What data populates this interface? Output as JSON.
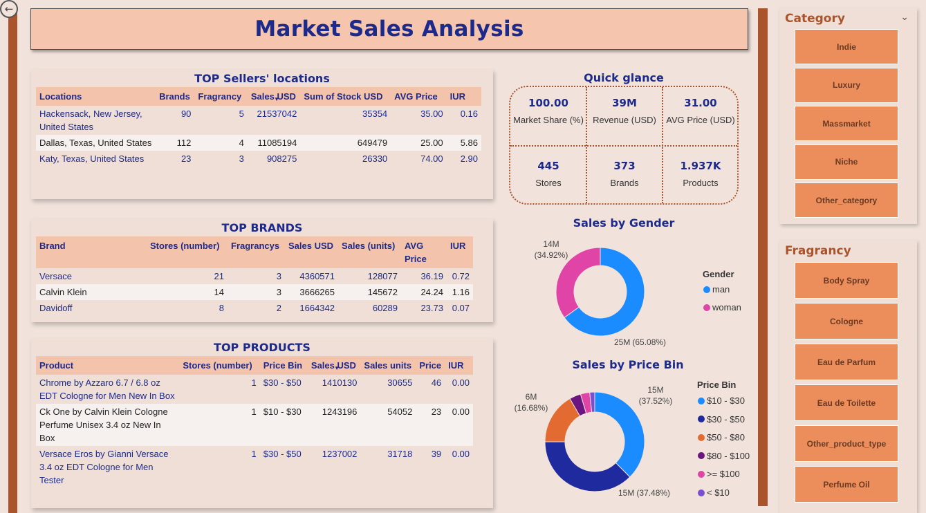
{
  "page": {
    "title": "Market Sales Analysis",
    "back_icon": "back-arrow-icon"
  },
  "sellers": {
    "title": "TOP Sellers' locations",
    "columns": [
      "Locations",
      "Brands",
      "Fragrancy",
      "Sales USD",
      "Sum of Stock USD",
      "AVG Price",
      "IUR"
    ],
    "rows": [
      [
        "Hackensack, New Jersey, United States",
        "90",
        "5",
        "21537042",
        "35354",
        "35.00",
        "0.16"
      ],
      [
        "Dallas, Texas, United States",
        "112",
        "4",
        "11085194",
        "649479",
        "25.00",
        "5.86"
      ],
      [
        "Katy, Texas, United States",
        "23",
        "3",
        "908275",
        "26330",
        "74.00",
        "2.90"
      ]
    ]
  },
  "brands": {
    "title": "TOP BRANDS",
    "columns": [
      "Brand",
      "Stores (number)",
      "Fragrancys",
      "Sales USD",
      "Sales (units)",
      "AVG Price",
      "IUR"
    ],
    "rows": [
      [
        "Versace",
        "21",
        "3",
        "4360571",
        "128077",
        "36.19",
        "0.72"
      ],
      [
        "Calvin Klein",
        "14",
        "3",
        "3666265",
        "145672",
        "24.24",
        "1.16"
      ],
      [
        "Davidoff",
        "8",
        "2",
        "1664342",
        "60289",
        "23.73",
        "0.07"
      ]
    ]
  },
  "products": {
    "title": "TOP PRODUCTS",
    "columns": [
      "Product",
      "Stores (number)",
      "Price Bin",
      "Sales USD",
      "Sales units",
      "Price",
      "IUR"
    ],
    "rows": [
      [
        "Chrome by Azzaro 6.7 / 6.8 oz EDT Cologne for Men New In Box",
        "1",
        "$30 - $50",
        "1410130",
        "30655",
        "46",
        "0.00"
      ],
      [
        "Ck One by Calvin Klein Cologne Perfume Unisex 3.4 oz New In Box",
        "1",
        "$10 - $30",
        "1243196",
        "54052",
        "23",
        "0.00"
      ],
      [
        "Versace Eros by Gianni Versace 3.4 oz EDT Cologne for Men Tester",
        "1",
        "$30 - $50",
        "1237002",
        "31718",
        "39",
        "0.00"
      ]
    ]
  },
  "glance": {
    "title": "Quick glance",
    "kpis": [
      {
        "value": "100.00",
        "label": "Market Share (%)"
      },
      {
        "value": "39M",
        "label": "Revenue (USD)"
      },
      {
        "value": "31.00",
        "label": "AVG Price (USD)"
      },
      {
        "value": "445",
        "label": "Stores"
      },
      {
        "value": "373",
        "label": "Brands"
      },
      {
        "value": "1.937K",
        "label": "Products"
      }
    ]
  },
  "chart_data": [
    {
      "type": "pie",
      "title": "Sales by Gender",
      "legend_title": "Gender",
      "legend_position": "right",
      "categories": [
        "man",
        "woman"
      ],
      "values": [
        25,
        14
      ],
      "percents": [
        65.08,
        34.92
      ],
      "colors": [
        "#1a8cff",
        "#e044a7"
      ],
      "labels": [
        {
          "value": "25M",
          "pct": "(65.08%)"
        },
        {
          "value": "14M",
          "pct": "(34.92%)"
        }
      ]
    },
    {
      "type": "pie",
      "title": "Sales by Price Bin",
      "legend_title": "Price Bin",
      "legend_position": "right",
      "categories": [
        "$10 - $30",
        "$30 - $50",
        "$50 - $80",
        "$80 - $100",
        ">= $100",
        "< $10"
      ],
      "percents": [
        37.52,
        37.48,
        16.68,
        3.7,
        3.0,
        1.62
      ],
      "colors": [
        "#1a8cff",
        "#1f2a9e",
        "#e36b32",
        "#6b1580",
        "#e044a7",
        "#7b4fd1"
      ],
      "labels": [
        {
          "value": "15M",
          "pct": "(37.52%)"
        },
        {
          "value": "15M",
          "pct": "(37.48%)"
        },
        {
          "value": "6M",
          "pct": "(16.68%)"
        }
      ]
    }
  ],
  "category_slicer": {
    "title": "Category",
    "items": [
      "Indie",
      "Luxury",
      "Massmarket",
      "Niche",
      "Other_category"
    ]
  },
  "fragrancy_slicer": {
    "title": "Fragrancy",
    "items": [
      "Body Spray",
      "Cologne",
      "Eau de Parfum",
      "Eau de Toilette",
      "Other_product_type",
      "Perfume Oil"
    ]
  }
}
